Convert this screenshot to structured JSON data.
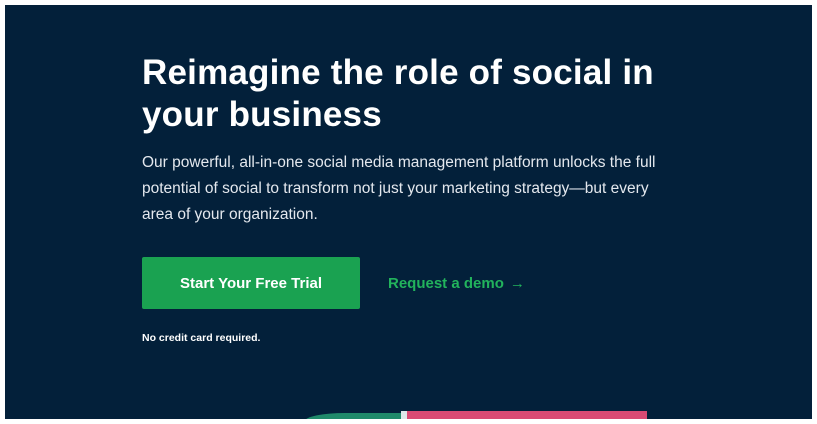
{
  "hero": {
    "headline": "Reimagine the role of social in your business",
    "description": "Our powerful, all-in-one social media management platform unlocks the full potential of social to transform not just your marketing strategy—but every area of your organization.",
    "primary_cta_label": "Start Your Free Trial",
    "secondary_cta_label": "Request a demo",
    "secondary_cta_icon": "arrow-right-icon",
    "secondary_cta_arrow": "→",
    "fineprint": "No credit card required."
  },
  "colors": {
    "background": "#03203a",
    "accent_green": "#1aa251",
    "link_green": "#22b35c",
    "text_white": "#ffffff"
  }
}
